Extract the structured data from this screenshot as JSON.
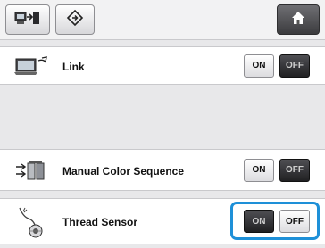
{
  "toolbar": {
    "left_icon": "machine-transfer-icon",
    "second_icon": "direction-diamond-icon",
    "home_icon": "home-icon"
  },
  "settings": [
    {
      "label": "Link",
      "icon": "computer-link-icon",
      "on_label": "ON",
      "off_label": "OFF",
      "selected": "OFF"
    },
    {
      "label": "Manual Color Sequence",
      "icon": "color-sequence-icon",
      "on_label": "ON",
      "off_label": "OFF",
      "selected": "OFF"
    },
    {
      "label": "Thread Sensor",
      "icon": "thread-spool-icon",
      "on_label": "ON",
      "off_label": "OFF",
      "selected": "ON"
    }
  ],
  "colors": {
    "highlight": "#1e90d8",
    "active_button": "#202022"
  }
}
